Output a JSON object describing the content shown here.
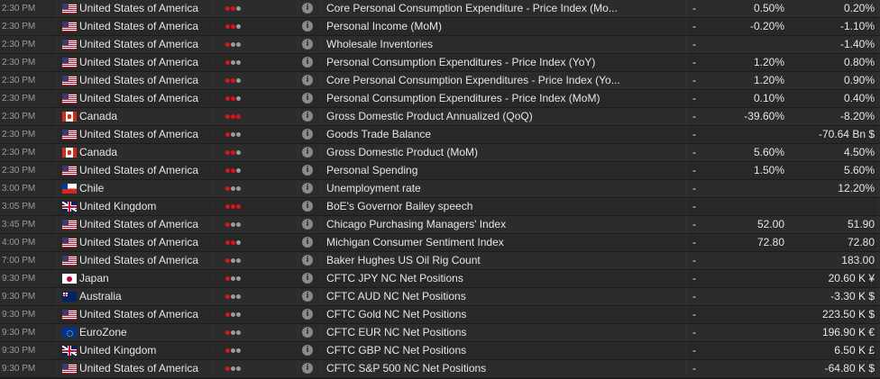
{
  "colors": {
    "importance_on": "#d8141c",
    "importance_off": "#9c9c9c",
    "row_bg": "#2b2b2b",
    "text": "#e6e6e6"
  },
  "rows": [
    {
      "time": "2:30 PM",
      "flag": "us",
      "country": "United States of America",
      "importance": 2,
      "event": "Core Personal Consumption Expenditure - Price Index (Mo...",
      "dash": "-",
      "actual": "0.50%",
      "forecast": "0.20%"
    },
    {
      "time": "2:30 PM",
      "flag": "us",
      "country": "United States of America",
      "importance": 2,
      "event": "Personal Income (MoM)",
      "dash": "-",
      "actual": "-0.20%",
      "forecast": "-1.10%"
    },
    {
      "time": "2:30 PM",
      "flag": "us",
      "country": "United States of America",
      "importance": 1,
      "event": "Wholesale Inventories",
      "dash": "-",
      "actual": "",
      "forecast": "-1.40%"
    },
    {
      "time": "2:30 PM",
      "flag": "us",
      "country": "United States of America",
      "importance": 1,
      "event": "Personal Consumption Expenditures - Price Index (YoY)",
      "dash": "-",
      "actual": "1.20%",
      "forecast": "0.80%"
    },
    {
      "time": "2:30 PM",
      "flag": "us",
      "country": "United States of America",
      "importance": 2,
      "event": "Core Personal Consumption Expenditures - Price Index (Yo...",
      "dash": "-",
      "actual": "1.20%",
      "forecast": "0.90%"
    },
    {
      "time": "2:30 PM",
      "flag": "us",
      "country": "United States of America",
      "importance": 2,
      "event": "Personal Consumption Expenditures - Price Index (MoM)",
      "dash": "-",
      "actual": "0.10%",
      "forecast": "0.40%"
    },
    {
      "time": "2:30 PM",
      "flag": "ca",
      "country": "Canada",
      "importance": 3,
      "event": "Gross Domestic Product Annualized (QoQ)",
      "dash": "-",
      "actual": "-39.60%",
      "forecast": "-8.20%"
    },
    {
      "time": "2:30 PM",
      "flag": "us",
      "country": "United States of America",
      "importance": 1,
      "event": "Goods Trade Balance",
      "dash": "-",
      "actual": "",
      "forecast": "-70.64 Bn $"
    },
    {
      "time": "2:30 PM",
      "flag": "ca",
      "country": "Canada",
      "importance": 2,
      "event": "Gross Domestic Product (MoM)",
      "dash": "-",
      "actual": "5.60%",
      "forecast": "4.50%"
    },
    {
      "time": "2:30 PM",
      "flag": "us",
      "country": "United States of America",
      "importance": 2,
      "event": "Personal Spending",
      "dash": "-",
      "actual": "1.50%",
      "forecast": "5.60%"
    },
    {
      "time": "3:00 PM",
      "flag": "cl",
      "country": "Chile",
      "importance": 1,
      "event": "Unemployment rate",
      "dash": "-",
      "actual": "",
      "forecast": "12.20%"
    },
    {
      "time": "3:05 PM",
      "flag": "uk",
      "country": "United Kingdom",
      "importance": 3,
      "event": "BoE's Governor Bailey speech",
      "dash": "-",
      "actual": "",
      "forecast": ""
    },
    {
      "time": "3:45 PM",
      "flag": "us",
      "country": "United States of America",
      "importance": 1,
      "event": "Chicago Purchasing Managers' Index",
      "dash": "-",
      "actual": "52.00",
      "forecast": "51.90"
    },
    {
      "time": "4:00 PM",
      "flag": "us",
      "country": "United States of America",
      "importance": 2,
      "event": "Michigan Consumer Sentiment Index",
      "dash": "-",
      "actual": "72.80",
      "forecast": "72.80"
    },
    {
      "time": "7:00 PM",
      "flag": "us",
      "country": "United States of America",
      "importance": 1,
      "event": "Baker Hughes US Oil Rig Count",
      "dash": "-",
      "actual": "",
      "forecast": "183.00"
    },
    {
      "time": "9:30 PM",
      "flag": "jp",
      "country": "Japan",
      "importance": 1,
      "event": "CFTC JPY NC Net Positions",
      "dash": "-",
      "actual": "",
      "forecast": "20.60 K ¥"
    },
    {
      "time": "9:30 PM",
      "flag": "au",
      "country": "Australia",
      "importance": 1,
      "event": "CFTC AUD NC Net Positions",
      "dash": "-",
      "actual": "",
      "forecast": "-3.30 K $"
    },
    {
      "time": "9:30 PM",
      "flag": "us",
      "country": "United States of America",
      "importance": 1,
      "event": "CFTC Gold NC Net Positions",
      "dash": "-",
      "actual": "",
      "forecast": "223.50 K $"
    },
    {
      "time": "9:30 PM",
      "flag": "eu",
      "country": "EuroZone",
      "importance": 1,
      "event": "CFTC EUR NC Net Positions",
      "dash": "-",
      "actual": "",
      "forecast": "196.90 K €"
    },
    {
      "time": "9:30 PM",
      "flag": "uk",
      "country": "United Kingdom",
      "importance": 1,
      "event": "CFTC GBP NC Net Positions",
      "dash": "-",
      "actual": "",
      "forecast": "6.50 K £"
    },
    {
      "time": "9:30 PM",
      "flag": "us",
      "country": "United States of America",
      "importance": 1,
      "event": "CFTC S&P 500 NC Net Positions",
      "dash": "-",
      "actual": "",
      "forecast": "-64.80 K $"
    }
  ]
}
